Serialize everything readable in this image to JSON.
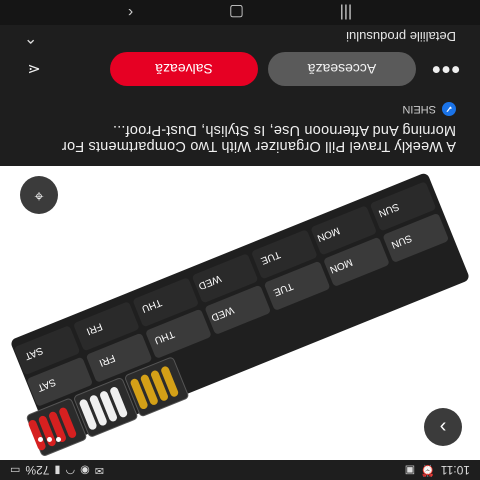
{
  "status_bar": {
    "time": "10:11",
    "battery": "72%"
  },
  "product": {
    "title": "A Weekly Travel Pill Organizer With Two Compartments For Morning And Afternoon Use, Is Stylish, Dust-Proof...",
    "source": "SHEIN"
  },
  "actions": {
    "visit_label": "Accesează",
    "save_label": "Salvează"
  },
  "details": {
    "label": "Detaliile produsului"
  },
  "icons": {
    "lens": "visual-search-icon",
    "next": "chevron-right-icon",
    "share": "share-icon",
    "menu": "more-icon"
  },
  "pill_box": {
    "days": [
      "SUN",
      "MON",
      "TUE",
      "WED",
      "THU",
      "FRI",
      "SAT"
    ],
    "day_colors": {
      "tray": "#2a2a2a",
      "lid": "#3a3a3a"
    },
    "pill_colors": [
      "#d4a017",
      "#f0f0f0",
      "#d62020"
    ]
  }
}
